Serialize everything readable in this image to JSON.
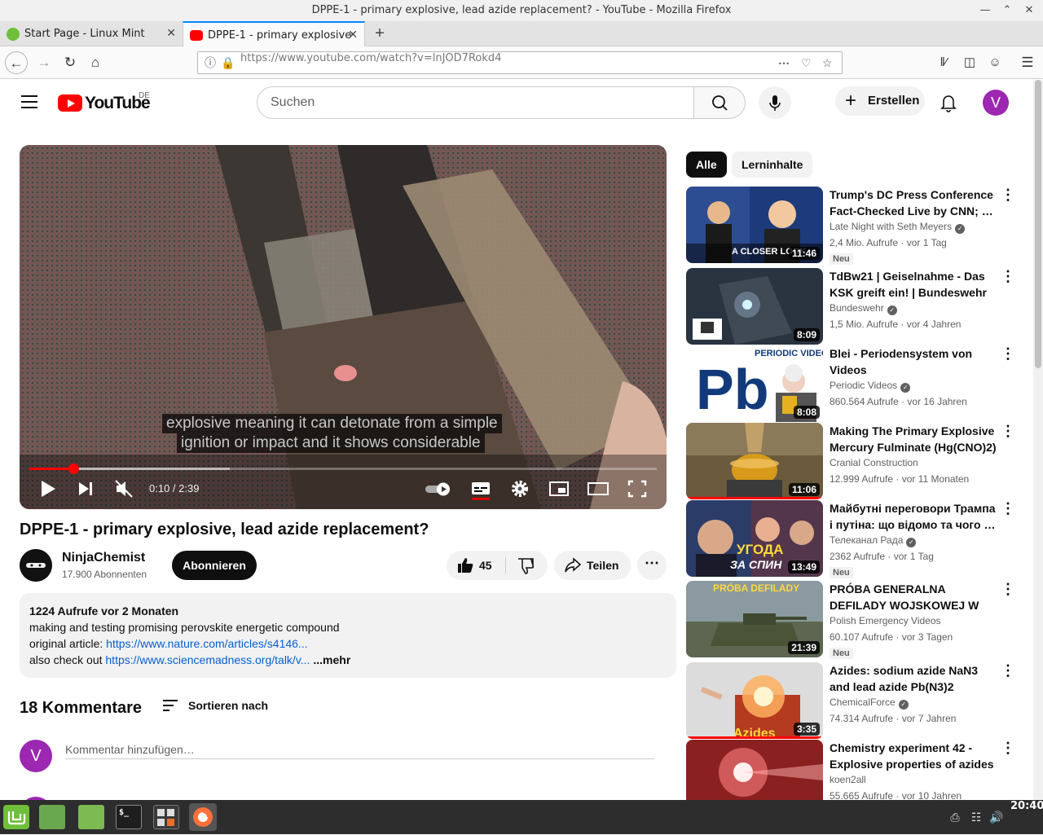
{
  "window": {
    "title": "DPPE-1 - primary explosive, lead azide replacement? - YouTube - Mozilla Firefox"
  },
  "browser": {
    "tabs": [
      {
        "label": "Start Page - Linux Mint",
        "active": false
      },
      {
        "label": "DPPE-1 - primary explosive",
        "active": true
      }
    ],
    "url": "https://www.youtube.com/watch?v=lnJOD7Rokd4"
  },
  "youtube": {
    "logo_text": "YouTube",
    "country": "DE",
    "search_placeholder": "Suchen",
    "create_label": "Erstellen",
    "avatar_letter": "V"
  },
  "player": {
    "caption_lines": [
      "explosive meaning it can detonate from a simple",
      "ignition or impact and it shows considerable"
    ],
    "time": "0:10 / 2:39",
    "progress": 0.07,
    "buffered": 0.32
  },
  "video": {
    "title": "DPPE-1 - primary explosive, lead azide replacement?",
    "channel": "NinjaChemist",
    "subscribers": "17.900 Abonnenten",
    "subscribe_label": "Abonnieren",
    "likes": "45",
    "share_label": "Teilen",
    "description": {
      "meta": "1224 Aufrufe  vor 2 Monaten",
      "line1": "making and testing promising perovskite energetic compound",
      "line2_prefix": "original article: ",
      "line2_link": "https://www.nature.com/articles/s4146...",
      "line3_prefix": "also check out ",
      "line3_link": "https://www.sciencemadness.org/talk/v...",
      "more": " ...mehr"
    }
  },
  "comments": {
    "count_label": "18 Kommentare",
    "sort_label": "Sortieren nach",
    "placeholder": "Kommentar hinzufügen…",
    "avatar_letter": "V"
  },
  "chips": [
    "Alle",
    "Lerninhalte"
  ],
  "recommendations": [
    {
      "title": "Trump's DC Press Conference Fact-Checked Live by CNN; …",
      "channel": "Late Night with Seth Meyers",
      "verified": true,
      "meta": "2,4 Mio. Aufrufe · vor 1 Tag",
      "badge": "Neu",
      "duration": "11:46",
      "thumb_text": "A CLOSER LOOK",
      "color": "#1d3b7a"
    },
    {
      "title": "TdBw21 | Geiselnahme - Das KSK greift ein! | Bundeswehr",
      "channel": "Bundeswehr",
      "verified": true,
      "meta": "1,5 Mio. Aufrufe · vor 4 Jahren",
      "badge": "",
      "duration": "8:09",
      "thumb_text": "",
      "color": "#2a3340"
    },
    {
      "title": "Blei - Periodensystem von Videos",
      "channel": "Periodic Videos",
      "verified": true,
      "meta": "860.564 Aufrufe · vor 16 Jahren",
      "badge": "",
      "duration": "8:08",
      "thumb_text": "Pb",
      "thumb_label": "PERIODIC VIDEOS",
      "color": "#ffffff"
    },
    {
      "title": "Making The Primary Explosive Mercury Fulminate (Hg(CNO)2)",
      "channel": "Cranial Construction",
      "verified": false,
      "meta": "12.999 Aufrufe · vor 11 Monaten",
      "badge": "",
      "duration": "11:06",
      "thumb_text": "",
      "color": "#6b5a3c"
    },
    {
      "title": "Майбутні переговори Трампа і путіна: що відомо та чого …",
      "channel": "Телеканал Рада",
      "verified": true,
      "meta": "2362 Aufrufe · vor 1 Tag",
      "badge": "Neu",
      "duration": "13:49",
      "thumb_text": "УГОДА",
      "thumb_label": "ЗА СПИН",
      "color": "#2c3c68"
    },
    {
      "title": "PRÓBA GENERALNA DEFILADY WOJSKOWEJ W WARSZAWIE …",
      "channel": "Polish Emergency Videos",
      "verified": false,
      "meta": "60.107 Aufrufe · vor 3 Tagen",
      "badge": "Neu",
      "duration": "21:39",
      "thumb_text": "PRÓBA DEFILADY",
      "color": "#5d6650"
    },
    {
      "title": "Azides: sodium azide NaN3 and lead azide Pb(N3)2",
      "channel": "ChemicalForce",
      "verified": true,
      "meta": "74.314 Aufrufe · vor 7 Jahren",
      "badge": "",
      "duration": "3:35",
      "thumb_text": "Azides",
      "color": "#b43a20"
    },
    {
      "title": "Chemistry experiment 42 - Explosive properties of azides",
      "channel": "koen2all",
      "verified": false,
      "meta": "55.665 Aufrufe · vor 10 Jahren",
      "badge": "",
      "duration": "",
      "thumb_text": "",
      "color": "#8a2020"
    }
  ],
  "taskbar": {
    "clock": "20:40"
  },
  "colors": {
    "accent": "#ff0000",
    "link": "#065fd4",
    "avatar": "#9c27b0"
  }
}
